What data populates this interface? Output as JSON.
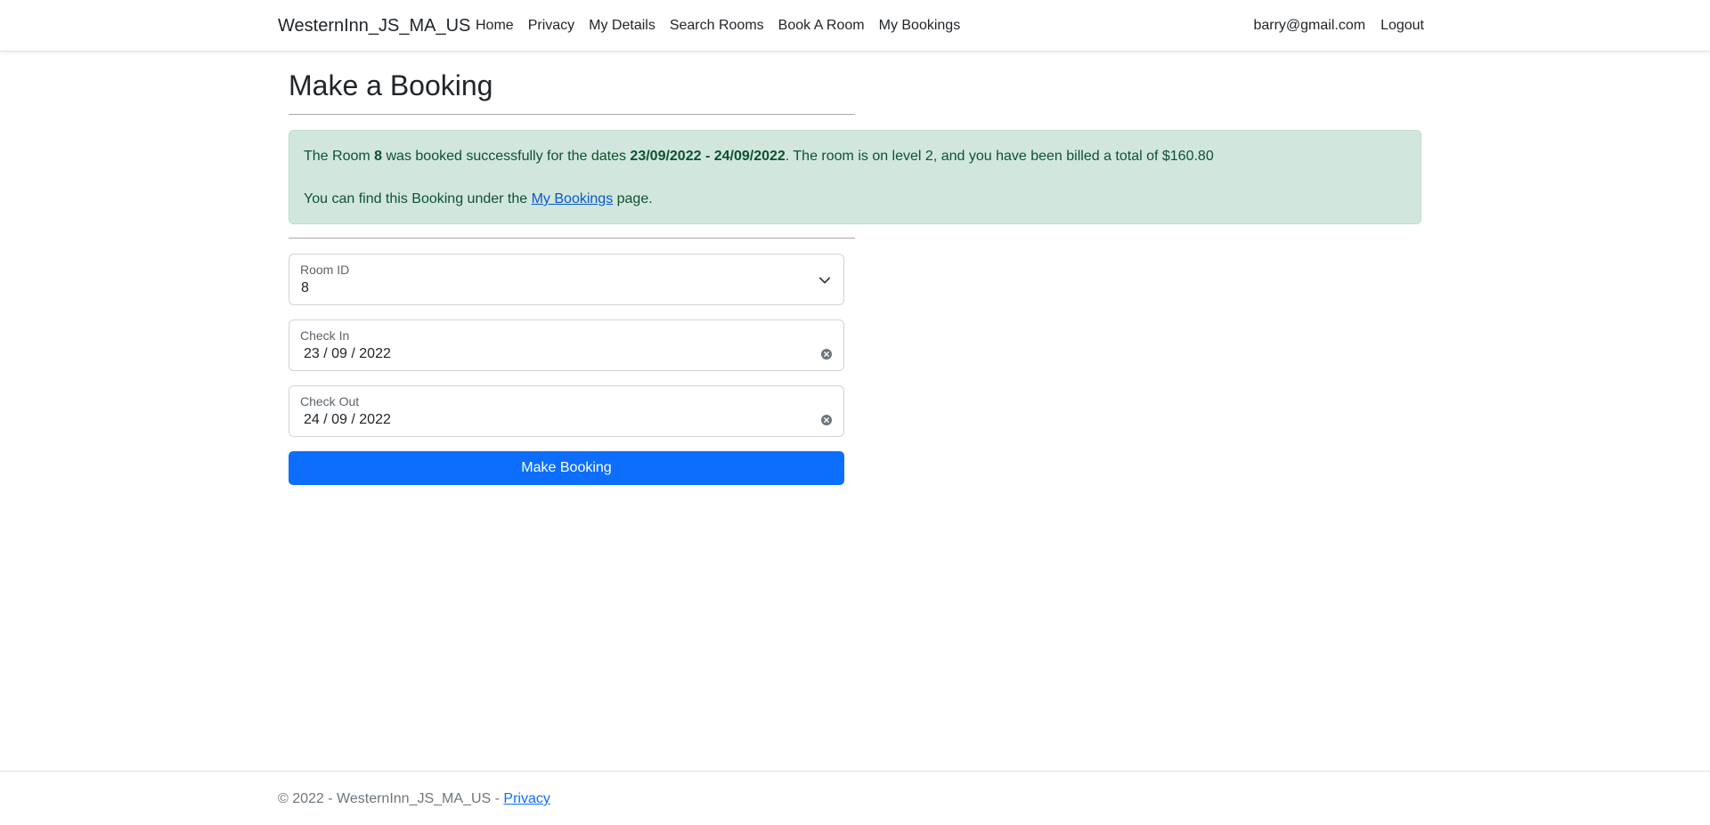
{
  "navbar": {
    "brand": "WesternInn_JS_MA_US",
    "links": [
      "Home",
      "Privacy",
      "My Details",
      "Search Rooms",
      "Book A Room",
      "My Bookings"
    ],
    "user_email": "barry@gmail.com",
    "logout": "Logout"
  },
  "page": {
    "title": "Make a Booking"
  },
  "alert": {
    "text1": "The Room ",
    "room": "8",
    "text2": " was booked successfully for the dates ",
    "dates": "23/09/2022 - 24/09/2022",
    "text3": ". The room is on level 2, and you have been billed a total of $160.80",
    "text4": "You can find this Booking under the ",
    "link": "My Bookings",
    "text5": " page."
  },
  "form": {
    "room_label": "Room ID",
    "room_value": "8",
    "checkin_label": "Check In",
    "checkin_value": "23 / 09 / 2022",
    "checkout_label": "Check Out",
    "checkout_value": "24 / 09 / 2022",
    "submit": "Make Booking"
  },
  "footer": {
    "text": "© 2022 - WesternInn_JS_MA_US - ",
    "link": "Privacy"
  },
  "icons": {
    "room_select": "chevron-down-icon",
    "clear_date": "clear-circle-icon"
  },
  "colors": {
    "primary": "#0d6efd",
    "alert_bg": "#d1e7dd",
    "alert_text": "#0f5132"
  }
}
